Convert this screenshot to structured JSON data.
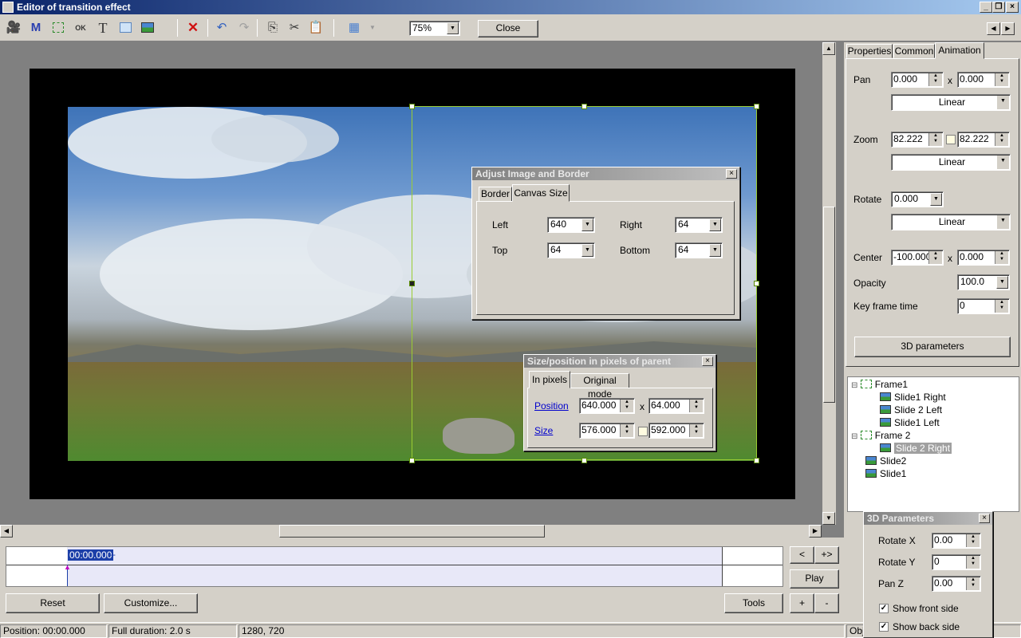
{
  "window": {
    "title": "Editor of transition effect"
  },
  "toolbar": {
    "zoom_value": "75%",
    "close_label": "Close",
    "icons": [
      "camera-icon",
      "m-icon",
      "frame-icon",
      "ok-icon",
      "text-icon",
      "rectangle-icon",
      "image-icon",
      "delete-icon",
      "undo-icon",
      "redo-icon",
      "copy-icon",
      "cut-icon",
      "paste-icon",
      "grid-icon"
    ],
    "nav_prev": "◀",
    "nav_next": "▶"
  },
  "canvas": {
    "resolution": "1280, 720"
  },
  "adjust_dialog": {
    "title": "Adjust Image and Border",
    "tabs": [
      "Border",
      "Canvas Size"
    ],
    "active_tab": "Canvas Size",
    "left_label": "Left",
    "left_value": "640",
    "right_label": "Right",
    "right_value": "64",
    "top_label": "Top",
    "top_value": "64",
    "bottom_label": "Bottom",
    "bottom_value": "64"
  },
  "size_dialog": {
    "title": "Size/position in pixels of parent",
    "tabs": [
      "In pixels",
      "Original mode"
    ],
    "position_label": "Position",
    "position_x": "640.000",
    "position_y": "64.000",
    "size_label": "Size",
    "size_w": "576.000",
    "size_h": "592.000",
    "x_sep": "x"
  },
  "timeline": {
    "time": "00:00.000",
    "plus": "+"
  },
  "bottom": {
    "reset_label": "Reset",
    "customize_label": "Customize...",
    "tools_label": "Tools",
    "prev_label": "<",
    "next_label": "+>",
    "play_label": "Play",
    "plus_label": "+",
    "minus_label": "-"
  },
  "status": {
    "position": "Position:  00:00.000",
    "duration": "Full duration:  2.0 s",
    "resolution": "1280, 720",
    "obj": "Obj"
  },
  "right_panel": {
    "tabs": [
      "Properties",
      "Common",
      "Animation"
    ],
    "active_tab": "Animation",
    "pan_label": "Pan",
    "pan_x": "0.000",
    "pan_y": "0.000",
    "pan_interp": "Linear",
    "zoom_label": "Zoom",
    "zoom_x": "82.222",
    "zoom_y": "82.222",
    "zoom_interp": "Linear",
    "rotate_label": "Rotate",
    "rotate_value": "0.000",
    "rotate_interp": "Linear",
    "center_label": "Center",
    "center_x": "-100.000",
    "center_y": "0.000",
    "opacity_label": "Opacity",
    "opacity_value": "100.0",
    "keyframe_label": "Key frame time",
    "keyframe_value": "0",
    "params3d_label": "3D parameters",
    "x_sep": "x"
  },
  "tree": {
    "items": [
      {
        "label": "Frame1",
        "type": "frame",
        "level": 0,
        "expand": "⊟"
      },
      {
        "label": "Slide1 Right",
        "type": "image",
        "level": 1
      },
      {
        "label": "Slide 2 Left",
        "type": "image",
        "level": 1
      },
      {
        "label": "Slide1 Left",
        "type": "image",
        "level": 1
      },
      {
        "label": "Frame 2",
        "type": "frame",
        "level": 0,
        "expand": "⊟"
      },
      {
        "label": "Slide 2 Right",
        "type": "image",
        "level": 1,
        "selected": true
      },
      {
        "label": "Slide2",
        "type": "image",
        "level": 0
      },
      {
        "label": "Slide1",
        "type": "image",
        "level": 0
      }
    ]
  },
  "params3d_dialog": {
    "title": "3D Parameters",
    "rotate_x_label": "Rotate X",
    "rotate_x": "0.00",
    "rotate_y_label": "Rotate Y",
    "rotate_y": "0",
    "pan_z_label": "Pan Z",
    "pan_z": "0.00",
    "show_front_label": "Show front side",
    "show_front": true,
    "show_back_label": "Show back side",
    "show_back": true
  },
  "colors": {
    "selection_border": "#9acd32",
    "title_gradient_start": "#0a246a",
    "title_gradient_end": "#a6caf0",
    "link": "#0000cc"
  }
}
